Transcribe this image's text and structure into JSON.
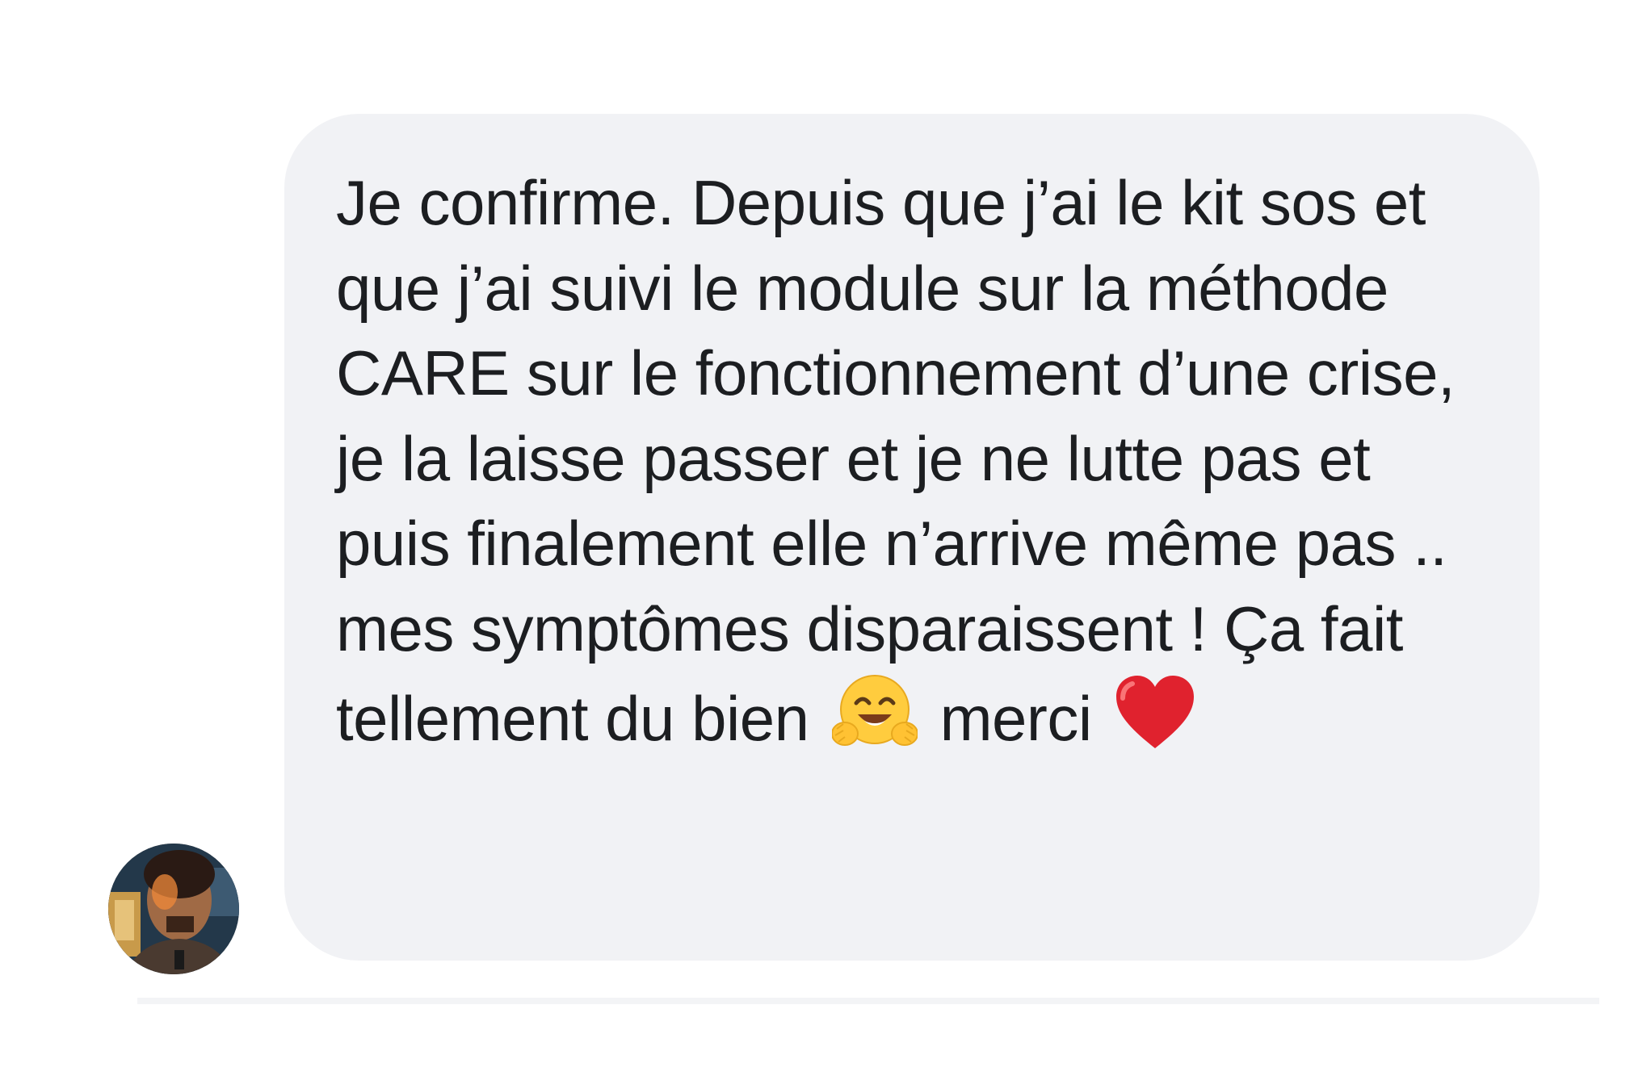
{
  "message": {
    "text_before_hug": "Je confirme. Depuis que j’ai le kit sos et que j’ai suivi le module sur la méthode CARE sur le fonctionnement d’une crise, je la laisse passer et je ne lutte pas et puis finalement elle n’arrive même pas .. mes symptômes disparaissent ! Ça fait tellement du bien",
    "text_before_heart": "merci",
    "hug_emoji_icon": "hugging-face-emoji",
    "heart_emoji_icon": "red-heart-emoji"
  },
  "sender": {
    "avatar_icon": "profile-photo"
  },
  "colors": {
    "bubble_background": "#f1f2f5",
    "text": "#1c1e21",
    "page_background": "#ffffff"
  }
}
